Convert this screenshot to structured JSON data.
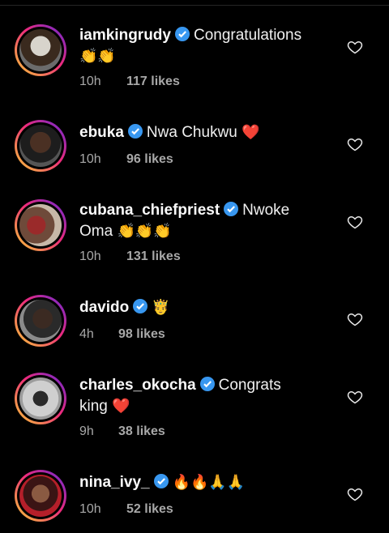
{
  "comments": [
    {
      "username": "iamkingrudy",
      "text": "Congratulations",
      "emojis": "👏👏",
      "time": "10h",
      "likes": "117 likes"
    },
    {
      "username": "ebuka",
      "text": "Nwa Chukwu",
      "emojis": "❤️",
      "time": "10h",
      "likes": "96 likes"
    },
    {
      "username": "cubana_chiefpriest",
      "text": "Nwoke",
      "text2": "Oma",
      "emojis": "👏👏👏",
      "time": "10h",
      "likes": "131 likes"
    },
    {
      "username": "davido",
      "text": "",
      "emojis": "🤴",
      "time": "4h",
      "likes": "98 likes"
    },
    {
      "username": "charles_okocha",
      "text": "Congrats",
      "text2": "king",
      "emojis": "❤️",
      "time": "9h",
      "likes": "38 likes"
    },
    {
      "username": "nina_ivy_",
      "text": "",
      "emojis": "🔥🔥🙏🙏",
      "time": "10h",
      "likes": "52 likes"
    }
  ],
  "colors": {
    "verified": "#3897f0",
    "heart": "#e0245e",
    "meta": "#a8a8a8"
  }
}
